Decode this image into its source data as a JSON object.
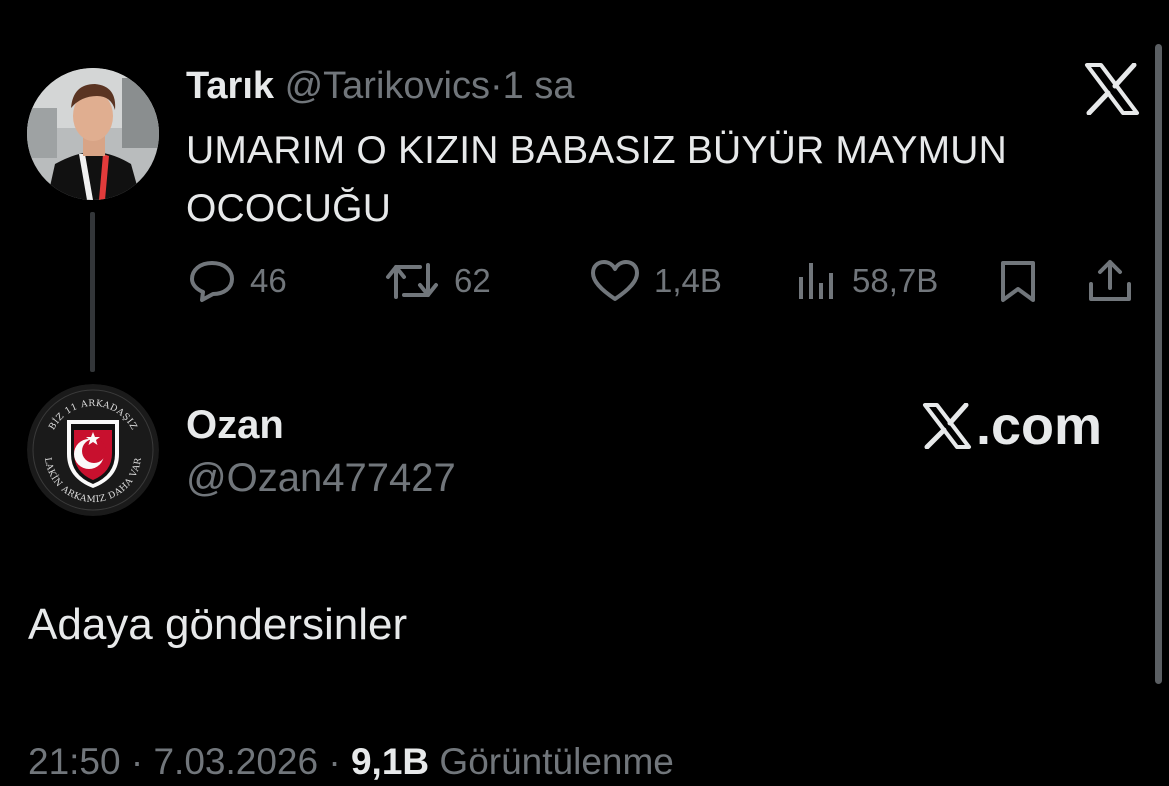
{
  "tweet": {
    "author_name": "Tarık",
    "handle": "@Tarikovics",
    "separator": "·",
    "time": "1 sa",
    "text": "UMARIM O KIZIN BABASIZ BÜYÜR MAYMUN OCOCUĞU",
    "actions": {
      "replies": "46",
      "retweets": "62",
      "likes": "1,4B",
      "views": "58,7B"
    }
  },
  "quoted": {
    "author_name": "Ozan",
    "handle": "@Ozan477427",
    "brand": ".com",
    "text": "Adaya göndersinler",
    "avatar_text_top": "BİZ 11 ARKADAŞIZ",
    "avatar_text_bottom": "LAKİN ARKAMIZ DAHA VAR",
    "footer": {
      "time": "21:50",
      "sep1": "·",
      "date": "7.03.2026",
      "sep2": "·",
      "views_count": "9,1B",
      "views_label": "Görüntülenme"
    }
  },
  "colors": {
    "background": "#000000",
    "text_primary": "#e7e9ea",
    "text_secondary": "#71767b",
    "bjk_red": "#c8102e"
  },
  "icons": [
    "reply-icon",
    "retweet-icon",
    "like-icon",
    "views-icon",
    "bookmark-icon",
    "share-icon",
    "x-logo-icon"
  ]
}
